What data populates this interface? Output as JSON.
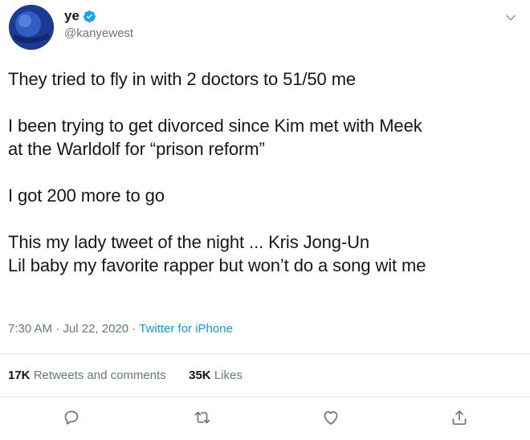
{
  "author": {
    "display_name": "ye",
    "handle": "@kanyewest",
    "verified": true
  },
  "tweet": {
    "paragraphs": [
      [
        "They tried to fly in with 2 doctors to 51/50 me"
      ],
      [
        "I been trying to get divorced since Kim met with Meek",
        "at the Warldolf for “prison reform”"
      ],
      [
        "I got 200 more to go"
      ],
      [
        "This my lady tweet of the night ... Kris Jong-Un",
        "Lil baby my favorite rapper but won’t do a song wit me"
      ]
    ],
    "time": "7:30 AM",
    "date": "Jul 22, 2020",
    "separator": "·",
    "source": "Twitter for iPhone"
  },
  "stats": {
    "retweets_count": "17K",
    "retweets_label": "Retweets and comments",
    "likes_count": "35K",
    "likes_label": "Likes"
  },
  "icons": {
    "more": "chevron-down-icon",
    "reply": "reply-icon",
    "retweet": "retweet-icon",
    "like": "heart-icon",
    "share": "share-icon"
  },
  "colors": {
    "verified": "#1da1f2",
    "link": "#1b95e0",
    "secondary": "#657786",
    "text": "#14171a"
  }
}
